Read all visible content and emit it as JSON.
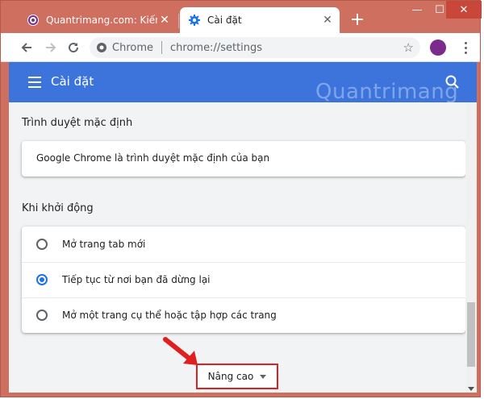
{
  "tabs": [
    {
      "title": "Quantrimang.com: Kiến Thức",
      "active": false
    },
    {
      "title": "Cài đặt",
      "active": true
    }
  ],
  "window_controls": {
    "minimize": "—",
    "maximize": "☐",
    "close": "✕"
  },
  "toolbar": {
    "chip_label": "Chrome",
    "url": "chrome://settings"
  },
  "settings_header": {
    "title": "Cài đặt",
    "watermark": "Quantrimang"
  },
  "sections": {
    "default_browser": {
      "title": "Trình duyệt mặc định",
      "status": "Google Chrome là trình duyệt mặc định của bạn"
    },
    "on_startup": {
      "title": "Khi khởi động",
      "options": [
        {
          "label": "Mở trang tab mới",
          "checked": false
        },
        {
          "label": "Tiếp tục từ nơi bạn đã dừng lại",
          "checked": true
        },
        {
          "label": "Mở một trang cụ thể hoặc tập hợp các trang",
          "checked": false
        }
      ]
    }
  },
  "advanced": {
    "label": "Nâng cao"
  },
  "colors": {
    "frame": "#cf6f5f",
    "header": "#3c74dc",
    "accent": "#1a73e8",
    "highlight": "#e02020"
  }
}
